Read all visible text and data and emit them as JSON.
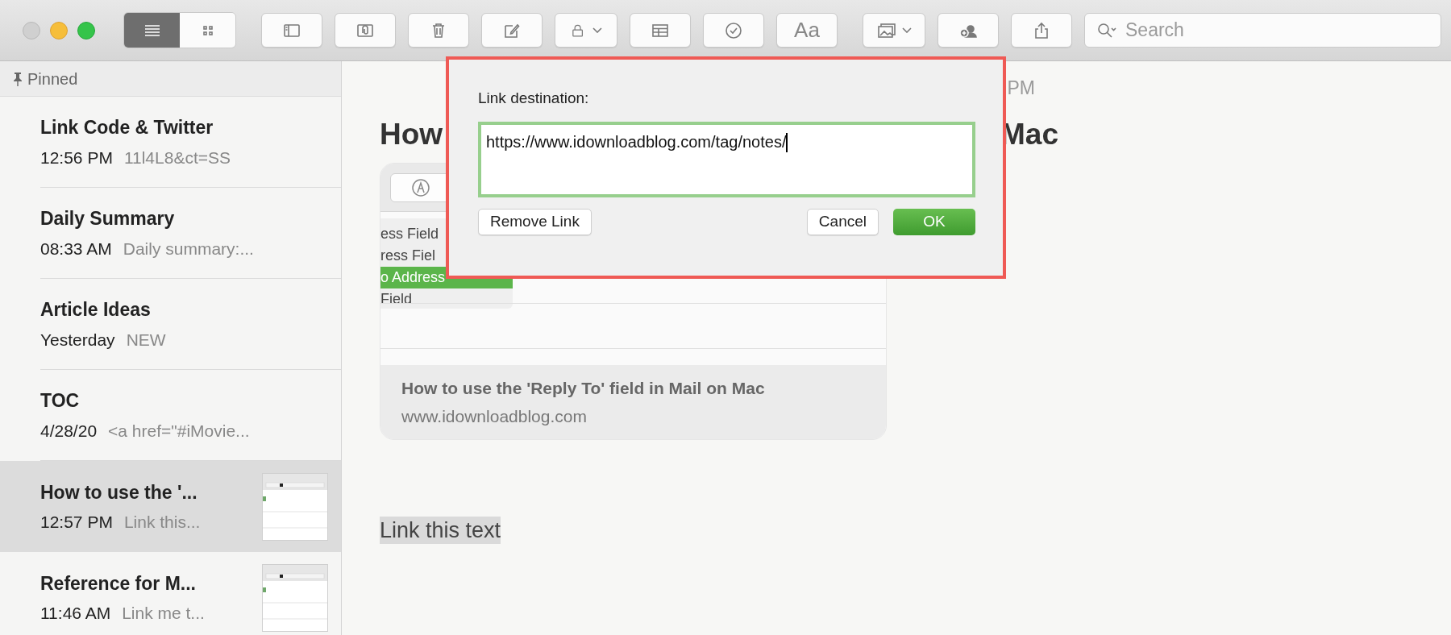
{
  "toolbar": {
    "view_mode": [
      {
        "selected": true
      },
      {
        "selected": false
      }
    ],
    "format_button": {
      "label": "Aa"
    },
    "search": {
      "placeholder": "Search"
    }
  },
  "sidebar": {
    "header": "Pinned",
    "notes": [
      {
        "title": "Link Code & Twitter",
        "time": "12:56 PM",
        "preview": "11l4L8&ct=SS",
        "selected": false,
        "thumbnail": false
      },
      {
        "title": "Daily Summary",
        "time": "08:33 AM",
        "preview": "Daily summary:...",
        "selected": false,
        "thumbnail": false
      },
      {
        "title": "Article Ideas",
        "time": "Yesterday",
        "preview": "NEW",
        "selected": false,
        "thumbnail": false
      },
      {
        "title": "TOC",
        "time": "4/28/20",
        "preview": "<a href=\"#iMovie...",
        "selected": false,
        "thumbnail": false
      },
      {
        "title": "How to use the '...",
        "time": "12:57 PM",
        "preview": "Link this...",
        "selected": true,
        "thumbnail": true
      },
      {
        "title": "Reference for M...",
        "time": "11:46 AM",
        "preview": "Link me t...",
        "selected": false,
        "thumbnail": true
      }
    ]
  },
  "note": {
    "date_fragment": "PM",
    "title_start": "How",
    "title_end": "Mac",
    "link_card": {
      "menu_items": [
        {
          "label": "ess Field",
          "selected": false
        },
        {
          "label": "ress Fiel",
          "selected": false
        },
        {
          "label": "o Address",
          "selected": true
        },
        {
          "label": "Field",
          "selected": false
        }
      ],
      "title": "How to use the 'Reply To' field in Mail on Mac",
      "url": "www.idownloadblog.com"
    },
    "selected_text": "Link this text"
  },
  "dialog": {
    "label": "Link destination:",
    "value": "https://www.idownloadblog.com/tag/notes/",
    "buttons": [
      {
        "label": "Remove Link",
        "kind": "secondary"
      },
      {
        "label": "Cancel",
        "kind": "secondary"
      },
      {
        "label": "OK",
        "kind": "primary"
      }
    ]
  }
}
